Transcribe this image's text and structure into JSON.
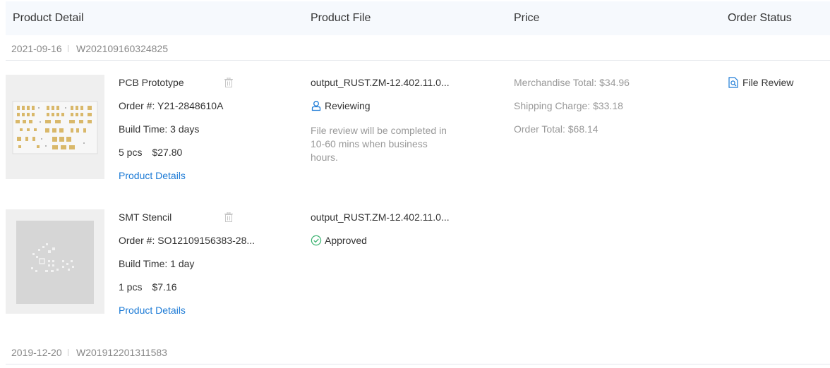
{
  "header": {
    "product_detail": "Product Detail",
    "product_file": "Product File",
    "price": "Price",
    "order_status": "Order Status"
  },
  "orders": [
    {
      "date": "2021-09-16",
      "order_number": "W202109160324825",
      "items": [
        {
          "name": "PCB Prototype",
          "order_no": "Order #: Y21-2848610A",
          "build_time": "Build Time: 3 days",
          "qty": "5 pcs",
          "price": "$27.80",
          "details_link": "Product Details",
          "file_name": "output_RUST.ZM-12.402.11.0...",
          "file_status": "Reviewing",
          "file_note": "File review will be completed in 10-60 mins when business hours.",
          "merchandise_total": "Merchandise Total: $34.96",
          "shipping_charge": "Shipping Charge: $33.18",
          "order_total": "Order Total: $68.14",
          "order_status": "File Review"
        },
        {
          "name": "SMT Stencil",
          "order_no": "Order #: SO12109156383-28...",
          "build_time": "Build Time: 1 day",
          "qty": "1 pcs",
          "price": "$7.16",
          "details_link": "Product Details",
          "file_name": "output_RUST.ZM-12.402.11.0...",
          "file_status": "Approved"
        }
      ]
    },
    {
      "date": "2019-12-20",
      "order_number": "W201912201311583"
    }
  ],
  "icons": {
    "trash": "trash-icon",
    "reviewing": "user-review-icon",
    "approved": "check-circle-icon",
    "file_review": "file-search-icon"
  },
  "colors": {
    "header_bg": "#f6f9fd",
    "link": "#1d7bd6",
    "approved": "#3cb371",
    "reviewing": "#1d7bd6",
    "muted": "#999999"
  }
}
